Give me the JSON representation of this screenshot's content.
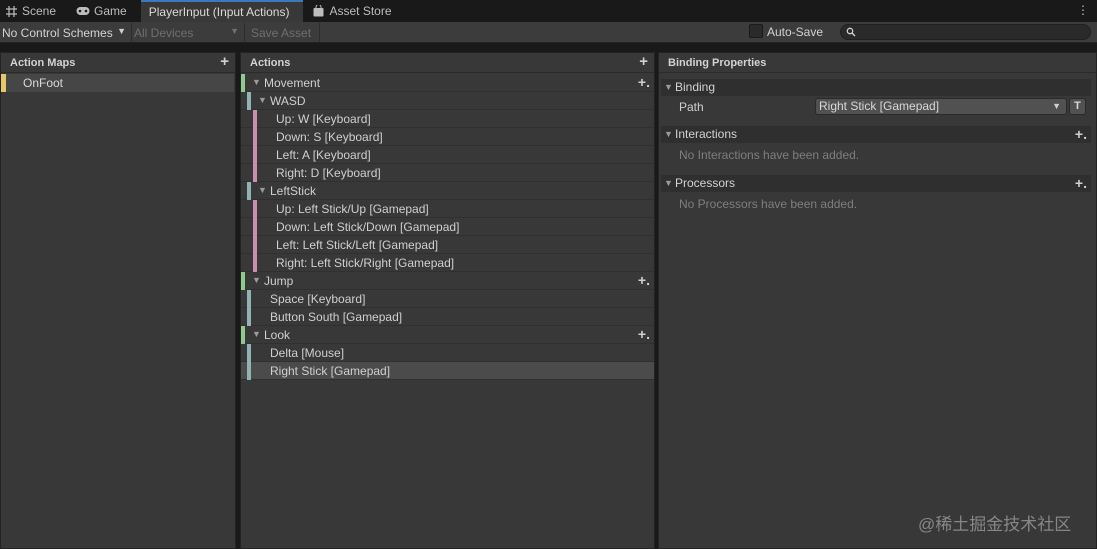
{
  "tabs": [
    {
      "label": "Scene",
      "icon": "grid-icon"
    },
    {
      "label": "Game",
      "icon": "gamepad-icon"
    },
    {
      "label": "PlayerInput (Input Actions)",
      "icon": ""
    },
    {
      "label": "Asset Store",
      "icon": "bag-icon"
    }
  ],
  "toolbar": {
    "control_schemes": "No Control Schemes",
    "devices": "All Devices",
    "save_asset": "Save Asset",
    "auto_save": "Auto-Save",
    "search_placeholder": ""
  },
  "action_maps": {
    "title": "Action Maps",
    "items": [
      {
        "label": "OnFoot"
      }
    ]
  },
  "actions": {
    "title": "Actions",
    "rows": [
      {
        "label": "Movement"
      },
      {
        "label": "WASD"
      },
      {
        "label": "Up: W [Keyboard]"
      },
      {
        "label": "Down: S [Keyboard]"
      },
      {
        "label": "Left: A [Keyboard]"
      },
      {
        "label": "Right: D [Keyboard]"
      },
      {
        "label": "LeftStick"
      },
      {
        "label": "Up: Left Stick/Up [Gamepad]"
      },
      {
        "label": "Down: Left Stick/Down [Gamepad]"
      },
      {
        "label": "Left: Left Stick/Left [Gamepad]"
      },
      {
        "label": "Right: Left Stick/Right [Gamepad]"
      },
      {
        "label": "Jump"
      },
      {
        "label": "Space [Keyboard]"
      },
      {
        "label": "Button South [Gamepad]"
      },
      {
        "label": "Look"
      },
      {
        "label": "Delta [Mouse]"
      },
      {
        "label": "Right Stick [Gamepad]"
      }
    ]
  },
  "binding_properties": {
    "title": "Binding Properties",
    "binding_section": "Binding",
    "path_label": "Path",
    "path_value": "Right Stick [Gamepad]",
    "t_button": "T",
    "interactions_section": "Interactions",
    "interactions_empty": "No Interactions have been added.",
    "processors_section": "Processors",
    "processors_empty": "No Processors have been added."
  },
  "colors": {
    "action_stripe": "#8fc98f",
    "composite_stripe": "#8fb4b4",
    "binding_stripe": "#c98fb0",
    "map_stripe": "#e8c66a"
  },
  "watermark": "@稀土掘金技术社区"
}
